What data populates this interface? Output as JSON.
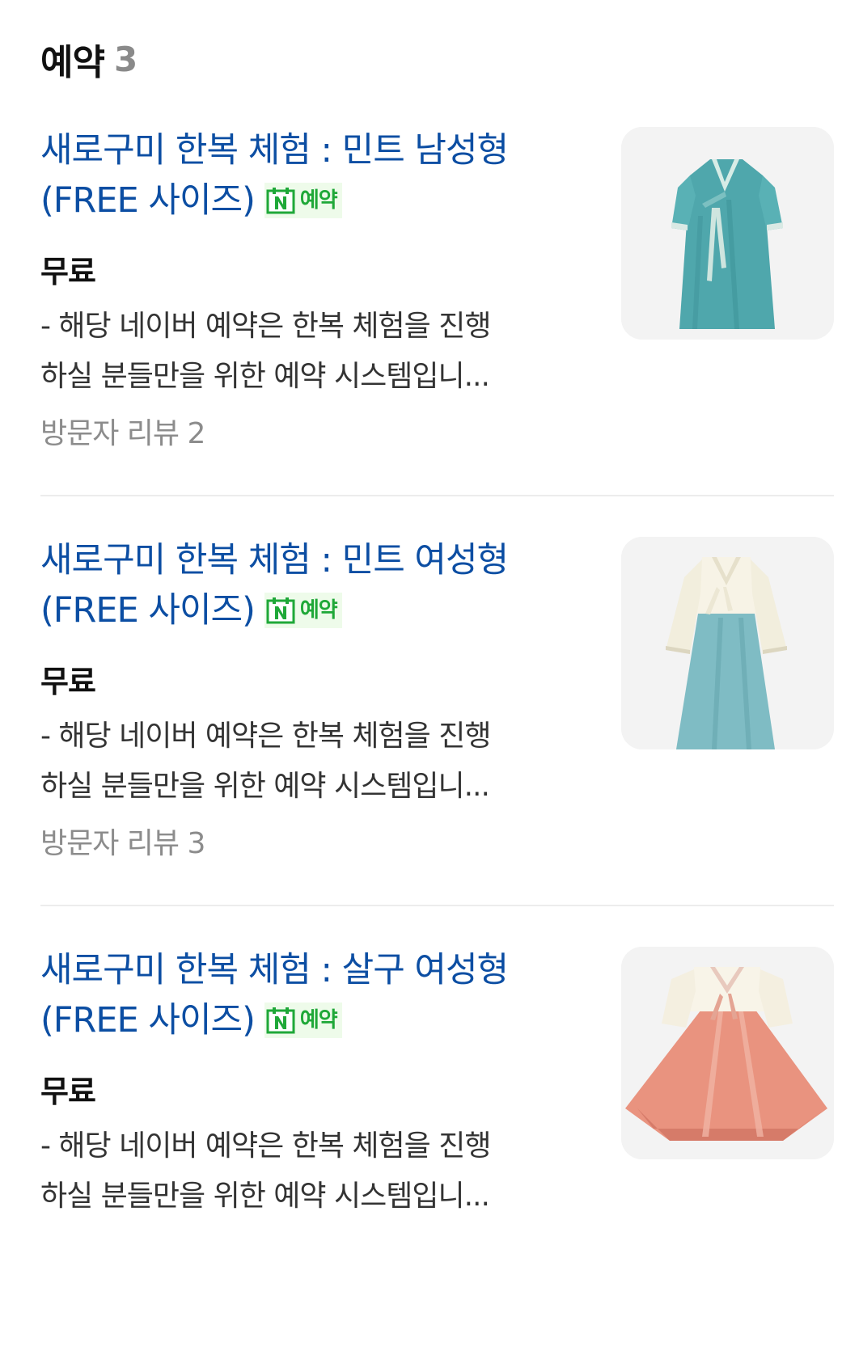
{
  "section": {
    "title": "예약",
    "count": "3"
  },
  "items": [
    {
      "title_line1": "새로구미 한복 체험 : 민트 남성형",
      "title_line2": "(FREE 사이즈)",
      "badge": "예약",
      "price": "무료",
      "desc_line1": "- 해당 네이버 예약은 한복 체험을 진행",
      "desc_line2": "하실 분들만을 위한 예약 시스템입니...",
      "review": "방문자 리뷰 2",
      "thumbnail_icon": "mint-male-hanbok-image"
    },
    {
      "title_line1": "새로구미 한복 체험 : 민트 여성형",
      "title_line2": "(FREE 사이즈)",
      "badge": "예약",
      "price": "무료",
      "desc_line1": "- 해당 네이버 예약은 한복 체험을 진행",
      "desc_line2": "하실 분들만을 위한 예약 시스템입니...",
      "review": "방문자 리뷰 3",
      "thumbnail_icon": "mint-female-hanbok-image"
    },
    {
      "title_line1": "새로구미 한복 체험 : 살구 여성형",
      "title_line2": "(FREE 사이즈)",
      "badge": "예약",
      "price": "무료",
      "desc_line1": "- 해당 네이버 예약은 한복 체험을 진행",
      "desc_line2": "하실 분들만을 위한 예약 시스템입니...",
      "thumbnail_icon": "apricot-female-hanbok-image"
    }
  ],
  "colors": {
    "title_link": "#0c4ea3",
    "badge_green": "#1fa838",
    "badge_bg": "#eefbea",
    "muted": "#8c8c8c",
    "divider": "#ececec"
  }
}
